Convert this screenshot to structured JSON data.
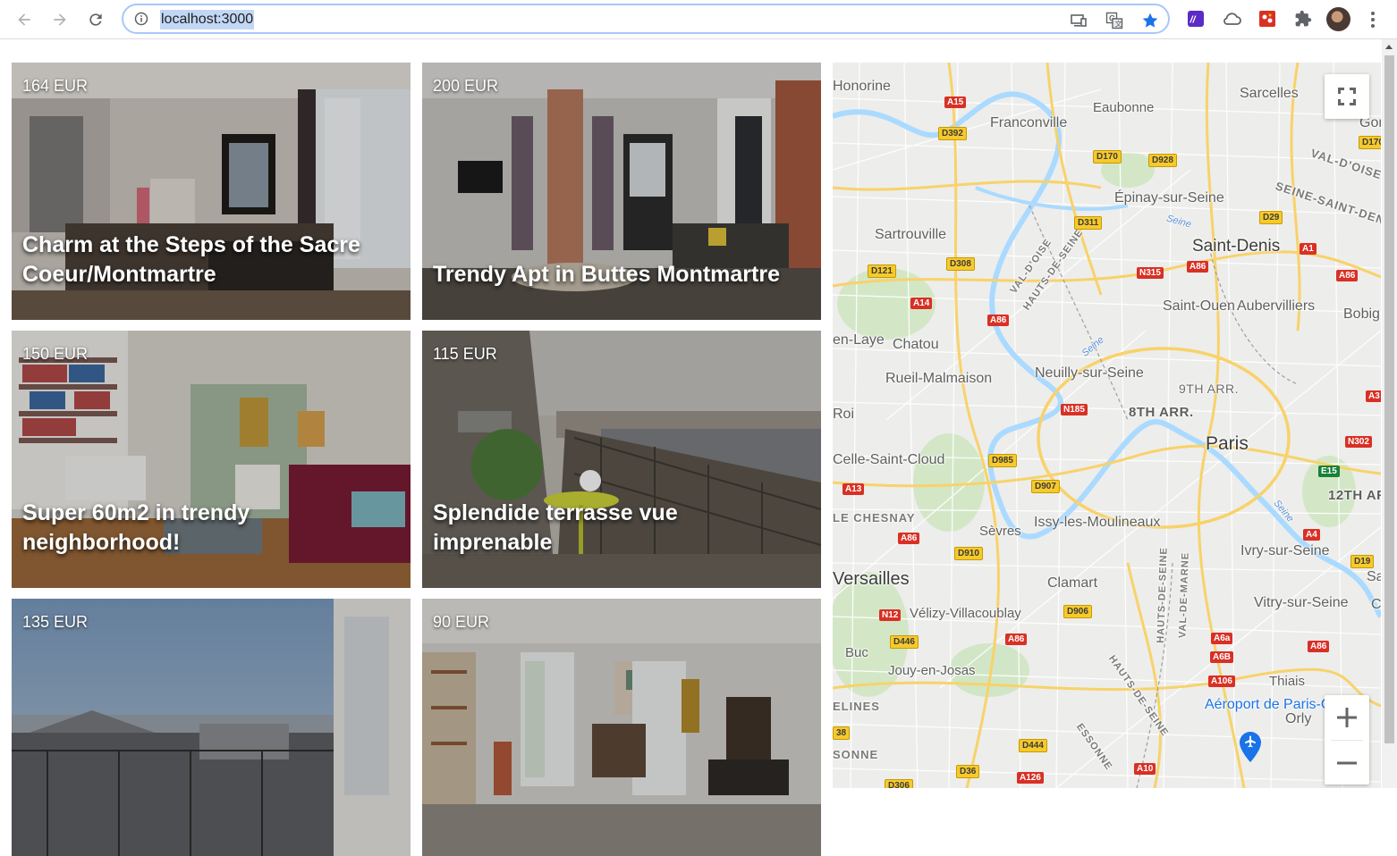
{
  "browser": {
    "url": "localhost:3000"
  },
  "listings": [
    {
      "price": "164 EUR",
      "title": "Charm at the Steps of the Sacre Coeur/Montmartre"
    },
    {
      "price": "200 EUR",
      "title": "Trendy Apt in Buttes Montmartre"
    },
    {
      "price": "150 EUR",
      "title": "Super 60m2 in trendy neighborhood!"
    },
    {
      "price": "115 EUR",
      "title": "Splendide terrasse vue imprenable"
    },
    {
      "price": "135 EUR",
      "title": ""
    },
    {
      "price": "90 EUR",
      "title": ""
    }
  ],
  "map": {
    "places": {
      "honorine": "Honorine",
      "sarcelles": "Sarcelles",
      "eaubonne": "Eaubonne",
      "franconville": "Franconville",
      "gon": "Gon",
      "val_doise": "VAL-D'OISE",
      "seine_saint_denis": "SEINE-SAINT-DENIS",
      "epinay": "Épinay-sur-Seine",
      "sartrouville": "Sartrouville",
      "saint_denis": "Saint-Denis",
      "saint_ouen": "Saint-Ouen",
      "aubervilliers": "Aubervilliers",
      "bobig": "Bobig",
      "en_laye": "en-Laye",
      "chatou": "Chatou",
      "rueil": "Rueil-Malmaison",
      "neuilly": "Neuilly-sur-Seine",
      "arr9": "9TH ARR.",
      "arr8": "8TH ARR.",
      "roi": "Roi",
      "paris": "Paris",
      "celle_saint_cloud": "Celle-Saint-Cloud",
      "arr12": "12TH AR",
      "le_chesnay": "LE CHESNAY",
      "sevres": "Sèvres",
      "issy": "Issy-les-Moulineaux",
      "ivry": "Ivry-sur-Seine",
      "versailles": "Versailles",
      "clamart": "Clamart",
      "sa": "Sa",
      "velizy": "Vélizy-Villacoublay",
      "vitry": "Vitry-sur-Seine",
      "c": "C",
      "buc": "Buc",
      "jouy": "Jouy-en-Josas",
      "thiais": "Thiais",
      "elines": "ELINES",
      "aeroport": "Aéroport de Paris-Orly",
      "orly": "Orly",
      "sonne": "SONNE",
      "hauts_de_seine": "HAUTS-DE-SEINE",
      "hauts_de_seine_2": "HAUTS-DE-SEINE",
      "hauts_de_seine_3": "HAUTS-DE-SEINE",
      "val_de_marne": "VAL-DE-MARNE",
      "val_doise_2": "VAL-D'OISE",
      "essonne": "ESSONNE",
      "seine_1": "Seine",
      "seine_2": "Seine",
      "seine_3": "Seine"
    },
    "roads": {
      "a15": "A15",
      "d392": "D392",
      "d170": "D170",
      "d928": "D928",
      "d170b": "D170",
      "d311": "D311",
      "d29": "D29",
      "d121": "D121",
      "d308": "D308",
      "n315": "N315",
      "a86a": "A86",
      "a1": "A1",
      "a86b": "A86",
      "a14": "A14",
      "a86c": "A86",
      "n185": "N185",
      "a3": "A3",
      "n302": "N302",
      "d985": "D985",
      "e15": "E15",
      "a13": "A13",
      "d907": "D907",
      "a86d": "A86",
      "a4": "A4",
      "d910": "D910",
      "d19": "D19",
      "n12": "N12",
      "d906": "D906",
      "a6a": "A6a",
      "d446": "D446",
      "a86e": "A86",
      "a6b": "A6B",
      "a86f": "A86",
      "a106": "A106",
      "d444": "D444",
      "d36": "D36",
      "a10": "A10",
      "a126": "A126",
      "d306": "D306",
      "d38": "38"
    }
  }
}
